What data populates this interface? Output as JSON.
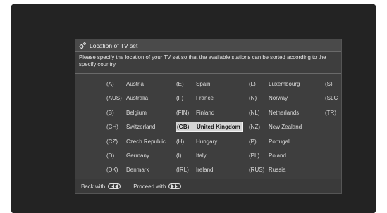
{
  "dialog": {
    "title": "Location of TV set",
    "instructions": "Please specify the location of your TV set so that the available stations can be sorted according to the specify country."
  },
  "countries": [
    [
      {
        "code": "(A)",
        "name": "Austria"
      },
      {
        "code": "(AUS)",
        "name": "Australia"
      },
      {
        "code": "(B)",
        "name": "Belgium"
      },
      {
        "code": "(CH)",
        "name": "Switzerland"
      },
      {
        "code": "(CZ)",
        "name": "Czech Republic"
      },
      {
        "code": "(D)",
        "name": "Germany"
      },
      {
        "code": "(DK)",
        "name": "Denmark"
      }
    ],
    [
      {
        "code": "(E)",
        "name": "Spain"
      },
      {
        "code": "(F)",
        "name": "France"
      },
      {
        "code": "(FIN)",
        "name": "Finland"
      },
      {
        "code": "(GB)",
        "name": "United Kingdom",
        "selected": true
      },
      {
        "code": "(H)",
        "name": "Hungary"
      },
      {
        "code": "(I)",
        "name": "Italy"
      },
      {
        "code": "(IRL)",
        "name": "Ireland"
      }
    ],
    [
      {
        "code": "(L)",
        "name": "Luxembourg"
      },
      {
        "code": "(N)",
        "name": "Norway"
      },
      {
        "code": "(NL)",
        "name": "Netherlands"
      },
      {
        "code": "(NZ)",
        "name": "New Zealand"
      },
      {
        "code": "(P)",
        "name": "Portugal"
      },
      {
        "code": "(PL)",
        "name": "Poland"
      },
      {
        "code": "(RUS)",
        "name": "Russia"
      }
    ],
    [
      {
        "code": "(S)",
        "name": ""
      },
      {
        "code": "(SLC",
        "name": ""
      },
      {
        "code": "(TR)",
        "name": ""
      }
    ]
  ],
  "footer": {
    "back_label": "Back with",
    "back_icon": "rewind-button-icon",
    "proceed_label": "Proceed with",
    "proceed_icon": "fast-forward-button-icon"
  }
}
